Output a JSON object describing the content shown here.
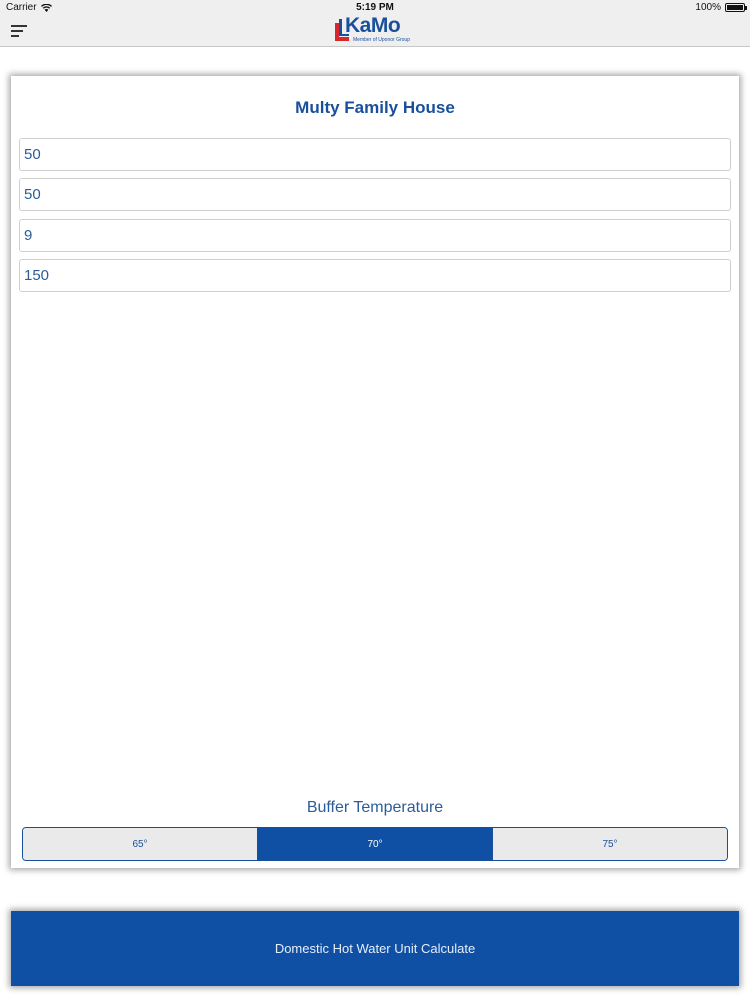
{
  "status_bar": {
    "carrier": "Carrier",
    "time": "5:19 PM",
    "battery": "100%"
  },
  "header": {
    "logo_text": "KaMo",
    "logo_subtitle": "Member of Uponor Group"
  },
  "form": {
    "title": "Multy Family House",
    "fields": [
      {
        "value": "50"
      },
      {
        "value": "50"
      },
      {
        "value": "9"
      },
      {
        "value": "150"
      }
    ]
  },
  "buffer": {
    "label": "Buffer Temperature",
    "options": [
      "65°",
      "70°",
      "75°"
    ],
    "selected": "70°"
  },
  "action": {
    "calculate_label": "Domestic Hot Water Unit Calculate"
  },
  "colors": {
    "brand_blue": "#0f50a5",
    "text_blue": "#2c5d99"
  }
}
